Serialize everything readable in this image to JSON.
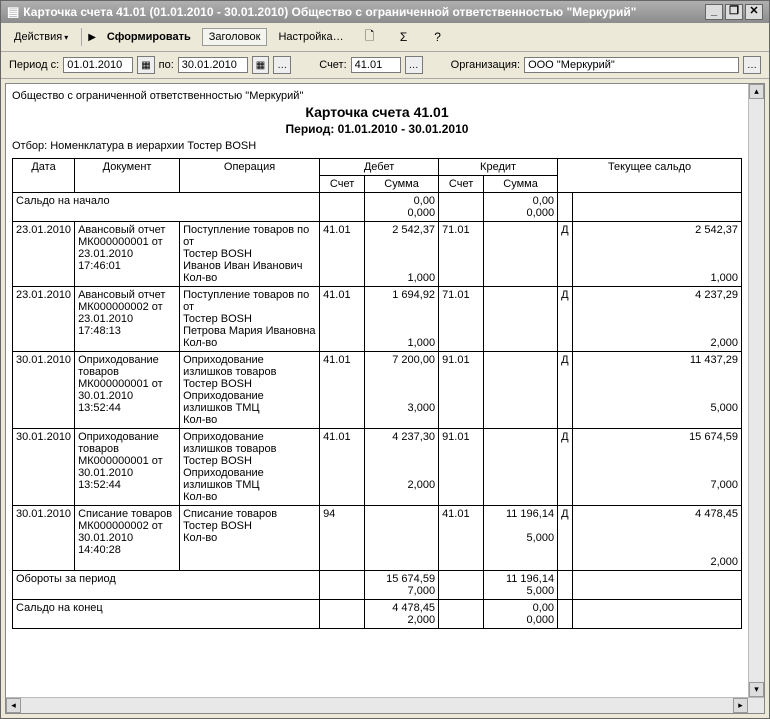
{
  "window": {
    "title": "Карточка счета 41.01 (01.01.2010 - 30.01.2010) Общество с ограниченной ответственностью \"Меркурий\""
  },
  "toolbar": {
    "actions": "Действия",
    "form": "Сформировать",
    "header": "Заголовок",
    "settings": "Настройка…"
  },
  "filter": {
    "period_label": "Период с:",
    "date_from": "01.01.2010",
    "to_label": "по:",
    "date_to": "30.01.2010",
    "acct_label": "Счет:",
    "acct_value": "41.01",
    "org_label": "Организация:",
    "org_value": "ООО \"Меркурий\""
  },
  "report": {
    "org": "Общество с ограниченной ответственностью \"Меркурий\"",
    "title": "Карточка счета 41.01",
    "period": "Период: 01.01.2010 - 30.01.2010",
    "filter": "Отбор: Номенклатура в иерархии Тостер BOSH",
    "headers": {
      "date": "Дата",
      "doc": "Документ",
      "op": "Операция",
      "debit": "Дебет",
      "credit": "Кредит",
      "balance": "Текущее сальдо",
      "acct": "Счет",
      "sum": "Сумма"
    },
    "start_balance_label": "Сальдо на начало",
    "start_balance": {
      "debit_sum": "0,00",
      "debit_qty": "0,000",
      "credit_sum": "0,00",
      "credit_qty": "0,000"
    },
    "rows": [
      {
        "date": "23.01.2010",
        "doc": "Авансовый отчет МК000000001 от 23.01.2010 17:46:01",
        "op": "Поступление товаров по  от\nТостер BOSH\nИванов Иван Иванович\nКол-во",
        "d_acct": "41.01",
        "d_sum": "2 542,37",
        "d_qty": "1,000",
        "c_acct": "71.01",
        "c_sum": "",
        "c_qty": "",
        "bal_dc": "Д",
        "bal_sum": "2 542,37",
        "bal_qty": "1,000"
      },
      {
        "date": "23.01.2010",
        "doc": "Авансовый отчет МК000000002 от 23.01.2010 17:48:13",
        "op": "Поступление товаров по  от\nТостер BOSH\nПетрова  Мария Ивановна\nКол-во",
        "d_acct": "41.01",
        "d_sum": "1 694,92",
        "d_qty": "1,000",
        "c_acct": "71.01",
        "c_sum": "",
        "c_qty": "",
        "bal_dc": "Д",
        "bal_sum": "4 237,29",
        "bal_qty": "2,000"
      },
      {
        "date": "30.01.2010",
        "doc": "Оприходование товаров МК000000001 от 30.01.2010 13:52:44",
        "op": "Оприходование излишков товаров\nТостер BOSH\nОприходование излишков ТМЦ\nКол-во",
        "d_acct": "41.01",
        "d_sum": "7 200,00",
        "d_qty": "3,000",
        "c_acct": "91.01",
        "c_sum": "",
        "c_qty": "",
        "bal_dc": "Д",
        "bal_sum": "11 437,29",
        "bal_qty": "5,000"
      },
      {
        "date": "30.01.2010",
        "doc": "Оприходование товаров МК000000001 от 30.01.2010 13:52:44",
        "op": "Оприходование излишков товаров\nТостер BOSH\nОприходование излишков ТМЦ\nКол-во",
        "d_acct": "41.01",
        "d_sum": "4 237,30",
        "d_qty": "2,000",
        "c_acct": "91.01",
        "c_sum": "",
        "c_qty": "",
        "bal_dc": "Д",
        "bal_sum": "15 674,59",
        "bal_qty": "7,000"
      },
      {
        "date": "30.01.2010",
        "doc": "Списание товаров МК000000002 от 30.01.2010 14:40:28",
        "op": "Списание товаров\nТостер BOSH\nКол-во",
        "d_acct": "94",
        "d_sum": "",
        "d_qty": "",
        "c_acct": "41.01",
        "c_sum": "11 196,14",
        "c_qty": "5,000",
        "bal_dc": "Д",
        "bal_sum": "4 478,45",
        "bal_qty": "2,000"
      }
    ],
    "turnover_label": "Обороты за период",
    "turnover": {
      "d_sum": "15 674,59",
      "d_qty": "7,000",
      "c_sum": "11 196,14",
      "c_qty": "5,000"
    },
    "end_balance_label": "Сальдо на конец",
    "end_balance": {
      "d_sum": "4 478,45",
      "d_qty": "2,000",
      "c_sum": "0,00",
      "c_qty": "0,000"
    }
  }
}
